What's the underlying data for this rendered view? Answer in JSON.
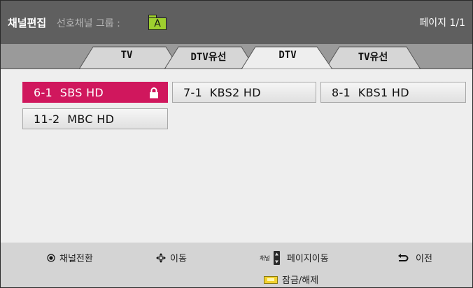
{
  "header": {
    "title": "채널편집",
    "group_label": "선호채널 그룹 :",
    "group_value": "A",
    "page": "페이지 1/1"
  },
  "tabs": [
    {
      "label": "TV",
      "selected": false
    },
    {
      "label": "DTV유선",
      "selected": false
    },
    {
      "label": "DTV",
      "selected": true
    },
    {
      "label": "TV유선",
      "selected": false
    }
  ],
  "channels": [
    {
      "label": "6-1  SBS HD",
      "selected": true,
      "locked": true
    },
    {
      "label": "7-1  KBS2 HD",
      "selected": false,
      "locked": false
    },
    {
      "label": "8-1  KBS1 HD",
      "selected": false,
      "locked": false
    },
    {
      "label": "11-2  MBC HD",
      "selected": false,
      "locked": false
    }
  ],
  "footer": {
    "switch_label": "채널전환",
    "move_label": "이동",
    "channel_small": "채널",
    "page_move_label": "페이지이동",
    "back_label": "이전",
    "lock_label": "잠금/해제"
  },
  "colors": {
    "header_bg": "#5f5f5f",
    "selected_channel": "#d0175d",
    "group_icon": "#9ecf2f",
    "footer_key": "#f2d230"
  },
  "icons": [
    "ok-button-icon",
    "arrows-icon",
    "channel-updown-icon",
    "back-icon",
    "yellow-key-icon",
    "lock-icon"
  ]
}
